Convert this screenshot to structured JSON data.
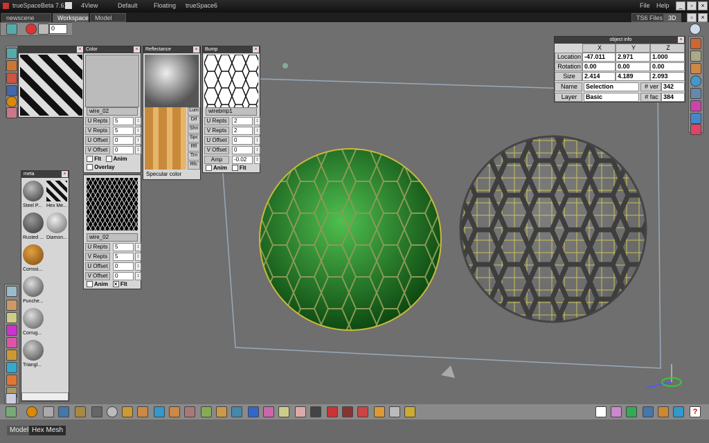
{
  "app": {
    "title": "trueSpaceBeta 7.61",
    "menu": [
      "File",
      "Help"
    ]
  },
  "tabs": [
    "newscene",
    "Workspace",
    "Model"
  ],
  "layouts": [
    "4View",
    "Default",
    "Floating",
    "trueSpace6"
  ],
  "right_tabs": {
    "ts6": "TS6 Files",
    "mode": "3D"
  },
  "toolbar": {
    "frame_value": "0"
  },
  "color_panel": {
    "title": "Color",
    "name": "wire_02",
    "rows": [
      {
        "label": "U Repts",
        "value": "5"
      },
      {
        "label": "V Repts",
        "value": "5"
      },
      {
        "label": "U Offset",
        "value": "0"
      },
      {
        "label": "V Offset",
        "value": "0"
      }
    ],
    "flt": "Flt",
    "anim": "Anim",
    "overlay": "Overlay"
  },
  "reflectance_panel": {
    "title": "Reflectance",
    "buttons": [
      "Lum",
      "Dif",
      "Shn",
      "Spc",
      "Rfl",
      "Trn",
      "Rfc"
    ],
    "specular": "Specular color"
  },
  "bump_panel": {
    "title": "Bump",
    "name": "wirebmp1",
    "rows": [
      {
        "label": "U Repts",
        "value": "2"
      },
      {
        "label": "V Repts",
        "value": "2"
      },
      {
        "label": "U Offset",
        "value": "0"
      },
      {
        "label": "V Offset",
        "value": "0"
      },
      {
        "label": "Amp",
        "value": "-0.02"
      }
    ],
    "anim": "Anim",
    "flt": "Flt"
  },
  "wire_panel": {
    "name": "wire_02",
    "rows": [
      {
        "label": "U Repts",
        "value": "5"
      },
      {
        "label": "V Repts",
        "value": "5"
      },
      {
        "label": "U Offset",
        "value": "0"
      },
      {
        "label": "V Offset",
        "value": "0"
      }
    ],
    "anim": "Anim",
    "flt": "Flt"
  },
  "metal_library": {
    "title": "meta",
    "items": [
      "Steel P...",
      "Hex Me...",
      "Rusted ...",
      "Diamon...",
      "Corrosi...",
      "Punche...",
      "Corrug...",
      "Triangl..."
    ]
  },
  "object_info": {
    "title": "object info",
    "cols": [
      "X",
      "Y",
      "Z"
    ],
    "rows": [
      {
        "label": "Location",
        "values": [
          "-47.011",
          "2.971",
          "1.000"
        ]
      },
      {
        "label": "Rotation",
        "values": [
          "0.00",
          "0.00",
          "0.00"
        ]
      },
      {
        "label": "Size",
        "values": [
          "2.414",
          "4.189",
          "2.093"
        ]
      }
    ],
    "name_label": "Name",
    "name_value": "Selection",
    "nver_label": "# ver",
    "nver": "342",
    "layer_label": "Layer",
    "layer_value": "Basic",
    "nfac_label": "# fac",
    "nfac": "384"
  },
  "status": {
    "model": "Model",
    "object": "Hex Mesh"
  }
}
